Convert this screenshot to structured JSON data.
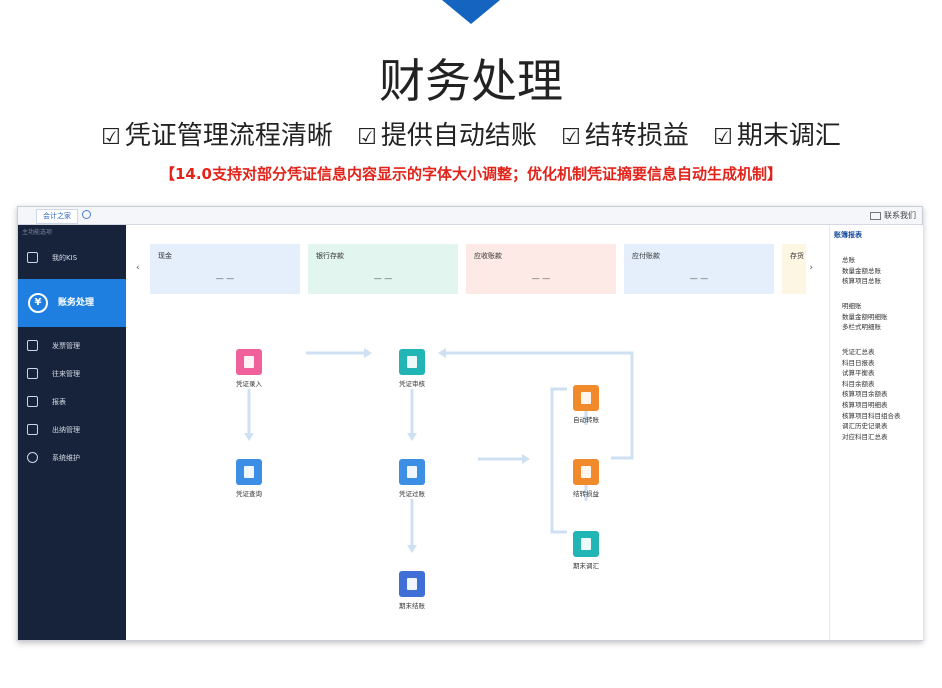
{
  "header": {
    "title": "财务处理",
    "features": [
      "凭证管理流程清晰",
      "提供自动结账",
      "结转损益",
      "期末调汇"
    ],
    "note": "【14.0支持对部分凭证信息内容显示的字体大小调整；优化机制凭证摘要信息自动生成机制】"
  },
  "window": {
    "tab_label": "会计之家",
    "contact_label": "联系我们",
    "side_hint": "主功能选项"
  },
  "sidebar": {
    "items": [
      {
        "label": "我的KIS"
      },
      {
        "label": "账务处理",
        "active": true
      },
      {
        "label": "发票管理"
      },
      {
        "label": "往来管理"
      },
      {
        "label": "报表"
      },
      {
        "label": "出纳管理"
      },
      {
        "label": "系统维护"
      }
    ]
  },
  "cards": [
    {
      "label": "现金",
      "value": "— —",
      "color": "#e4effb"
    },
    {
      "label": "银行存款",
      "value": "— —",
      "color": "#e2f5ef"
    },
    {
      "label": "应收账款",
      "value": "— —",
      "color": "#fdeae6"
    },
    {
      "label": "应付账款",
      "value": "— —",
      "color": "#e4effb"
    },
    {
      "label": "存货",
      "value": "",
      "color": "#fdf6e3"
    }
  ],
  "flow": {
    "voucher_entry": "凭证录入",
    "voucher_review": "凭证审核",
    "voucher_query": "凭证查询",
    "voucher_post": "凭证过账",
    "period_close": "期末结账",
    "auto_transfer": "自动转账",
    "pl_transfer": "结转损益",
    "period_fx": "期末调汇"
  },
  "right_panel": {
    "title": "账簿报表",
    "group1": [
      "总账",
      "数量金额总账",
      "核算项目总账"
    ],
    "group2": [
      "明细账",
      "数量金额明细账",
      "多栏式明细账"
    ],
    "group3": [
      "凭证汇总表",
      "科目日报表",
      "试算平衡表",
      "科目余额表",
      "核算项目余额表",
      "核算项目明细表",
      "核算项目科目组合表",
      "调汇历史记录表",
      "对应科目汇总表"
    ]
  }
}
